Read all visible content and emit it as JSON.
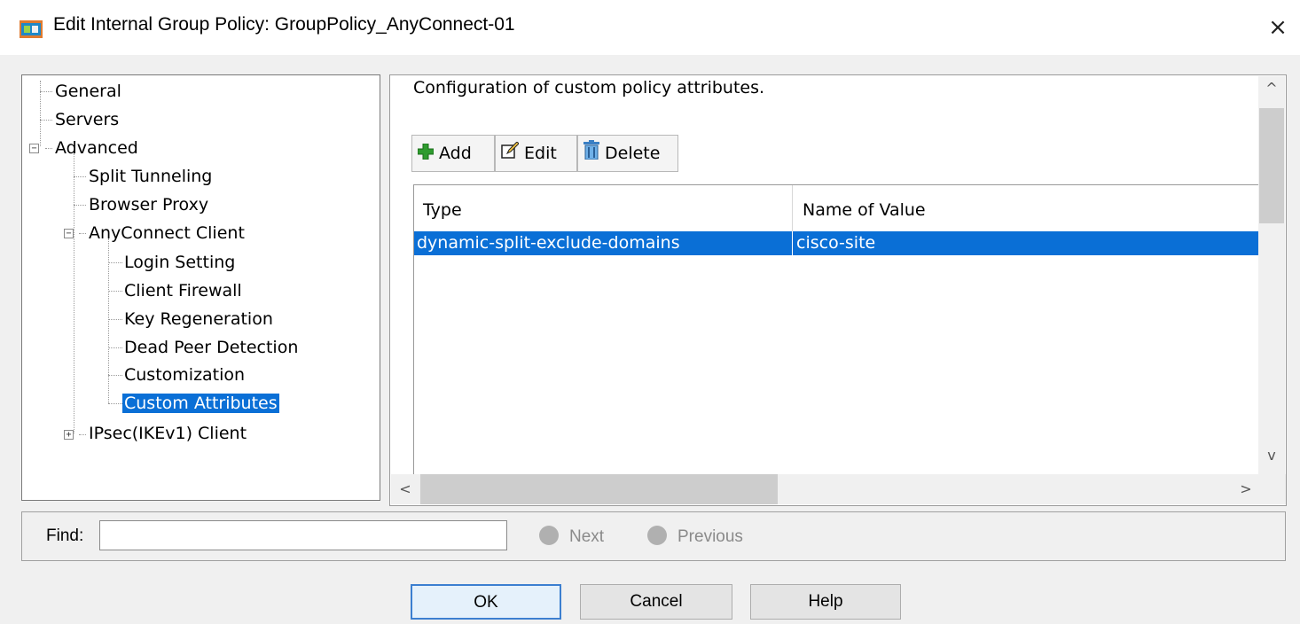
{
  "window": {
    "title": "Edit Internal Group Policy: GroupPolicy_AnyConnect-01",
    "close_glyph": "×",
    "app_icon": "asdm-window-icon"
  },
  "tree": {
    "general": "General",
    "servers": "Servers",
    "advanced": "Advanced",
    "split_tunneling": "Split Tunneling",
    "browser_proxy": "Browser Proxy",
    "anyconnect_client": "AnyConnect Client",
    "login_setting": "Login Setting",
    "client_firewall": "Client Firewall",
    "key_regeneration": "Key Regeneration",
    "dead_peer_detection": "Dead Peer Detection",
    "customization": "Customization",
    "custom_attributes": "Custom Attributes",
    "ipsec_client": "IPsec(IKEv1) Client",
    "expanded_glyph": "−",
    "collapsed_glyph": "+",
    "selected_item": "Custom Attributes"
  },
  "main": {
    "description": "Configuration of custom policy attributes.",
    "toolbar": {
      "add_label": "Add",
      "edit_label": "Edit",
      "delete_label": "Delete"
    },
    "table": {
      "columns": [
        "Type",
        "Name of Value"
      ],
      "rows": [
        [
          "dynamic-split-exclude-domains",
          "cisco-site"
        ]
      ],
      "selected_row": 0
    }
  },
  "scroll": {
    "up": "^",
    "down": "v",
    "left": "<",
    "right": ">"
  },
  "find": {
    "label": "Find:",
    "value": "",
    "next_label": "Next",
    "previous_label": "Previous"
  },
  "buttons": {
    "ok": "OK",
    "cancel": "Cancel",
    "help": "Help"
  },
  "colors": {
    "selection": "#0a6fd6",
    "add_icon": "#2e9b2e",
    "window_bg": "#f0f0f0"
  }
}
